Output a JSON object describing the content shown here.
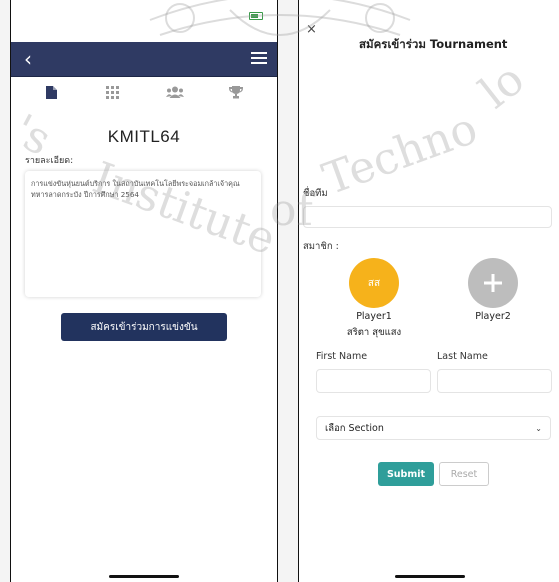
{
  "left_screen": {
    "event_title": "KMITL64",
    "detail_label": "รายละเอียด:",
    "detail_text": "การแข่งขันหุ่นยนต์บริการ ในสถาบันเทคโนโลยีพระจอมเกล้าเจ้าคุณทหารลาดกระบัง ปีการศึกษา 2564",
    "join_button_label": "สมัครเข้าร่วมการแข่งขัน",
    "tabs": [
      {
        "icon": "document-icon"
      },
      {
        "icon": "grid-icon"
      },
      {
        "icon": "users-icon"
      },
      {
        "icon": "trophy-icon"
      }
    ],
    "navbar_color": "#2f3a63"
  },
  "right_screen": {
    "close_label": "×",
    "modal_title": "สมัครเข้าร่วม Tournament",
    "team_name_label": "ชื่อทีม",
    "team_name_value": "",
    "members_label": "สมาชิก :",
    "player1": {
      "initials": "สส",
      "label": "Player1",
      "name": "สริตา สุขแสง",
      "color": "#f6b21b"
    },
    "player2": {
      "label": "Player2",
      "color": "#bdbdbd"
    },
    "first_name_label": "First Name",
    "last_name_label": "Last Name",
    "first_name_value": "",
    "last_name_value": "",
    "section_select": "เลือก Section",
    "submit_label": "Submit",
    "reset_label": "Reset",
    "submit_color": "#2f9e9a"
  }
}
